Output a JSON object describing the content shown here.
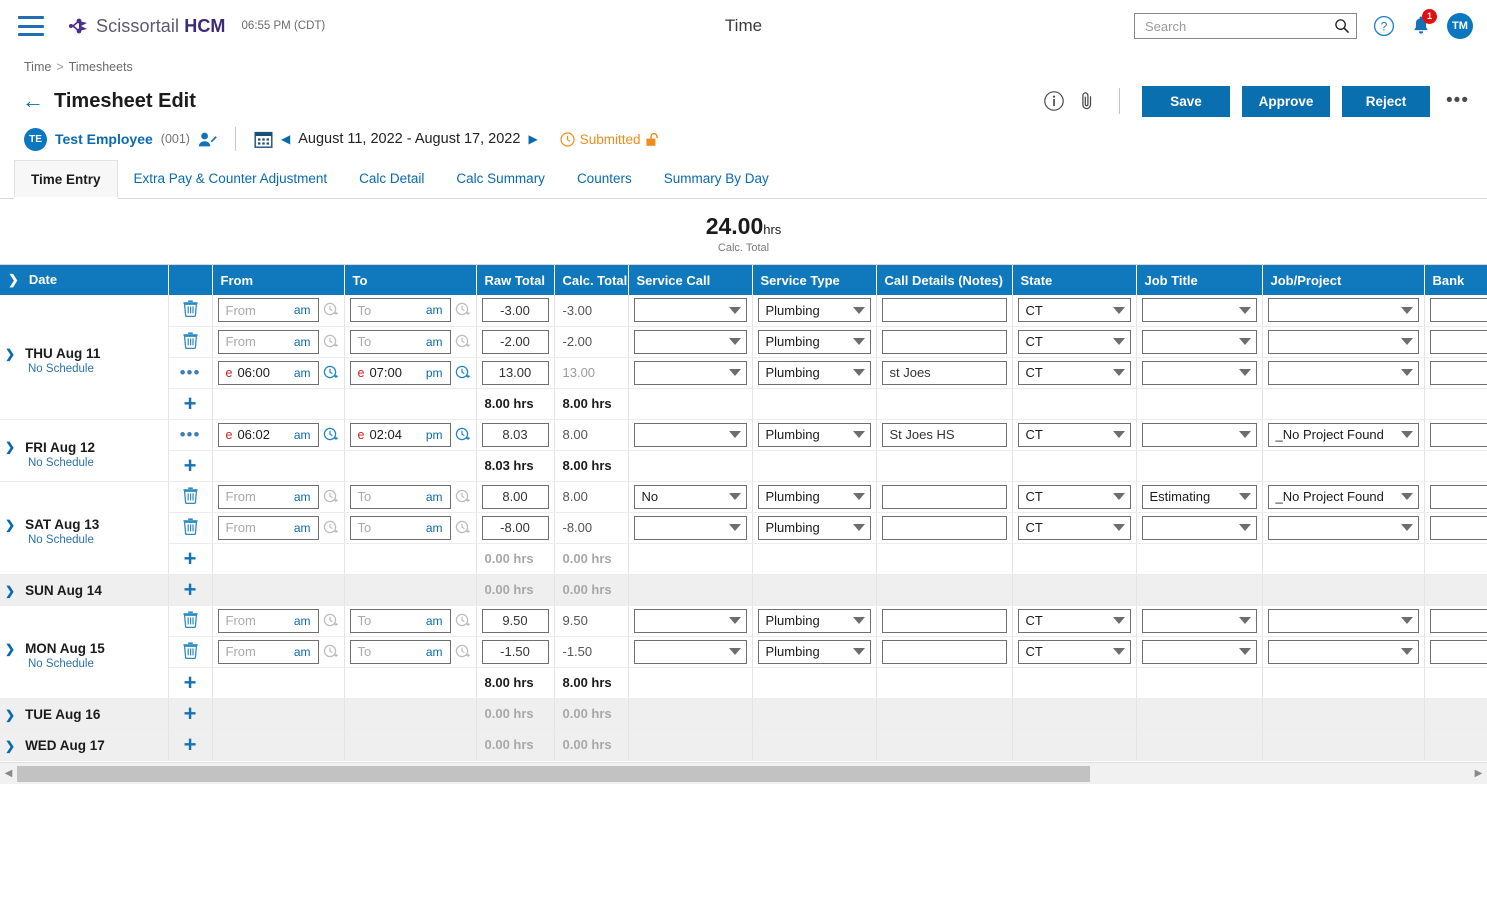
{
  "topbar": {
    "menu_icon": "hamburger-icon",
    "brand": "Scissortail ",
    "brand_bold": "HCM",
    "clock": "06:55 PM (CDT)",
    "page_title": "Time",
    "search": {
      "value": "",
      "placeholder": "Search"
    },
    "help_icon": "help-circle-icon",
    "notifications_icon": "bell-icon",
    "notifications_count": "1",
    "avatar_initials": "TM"
  },
  "breadcrumb": {
    "root": "Time",
    "separator": ">",
    "current": "Timesheets"
  },
  "header": {
    "back_icon": "back-arrow-icon",
    "title": "Timesheet Edit",
    "info_icon": "info-circle-icon",
    "attach_icon": "paperclip-icon",
    "save_label": "Save",
    "approve_label": "Approve",
    "reject_label": "Reject",
    "more_label": "•••"
  },
  "employee": {
    "avatar_initials": "TE",
    "name": "Test Employee",
    "id": "(001)",
    "edit_icon": "user-edit-icon",
    "calendar_icon": "calendar-icon",
    "prev_icon": "◀",
    "period": "August 11, 2022 - August 17, 2022",
    "next_icon": "▶",
    "status_icon": "clock-icon",
    "status": "Submitted",
    "lock_icon": "unlock-icon"
  },
  "tabs": [
    {
      "label": "Time Entry",
      "active": true
    },
    {
      "label": "Extra Pay & Counter Adjustment",
      "active": false
    },
    {
      "label": "Calc Detail",
      "active": false
    },
    {
      "label": "Calc Summary",
      "active": false
    },
    {
      "label": "Counters",
      "active": false
    },
    {
      "label": "Summary By Day",
      "active": false
    }
  ],
  "summary": {
    "value": "24.00",
    "unit": "hrs",
    "label": "Calc. Total"
  },
  "grid": {
    "columns": [
      "Date",
      "",
      "From",
      "To",
      "Raw Total",
      "Calc. Total",
      "Service Call",
      "Service Type",
      "Call Details (Notes)",
      "State",
      "Job Title",
      "Job/Project",
      "Bank"
    ],
    "placeholders": {
      "from": "From",
      "to": "To",
      "am": "am",
      "pm": "pm"
    },
    "days": [
      {
        "label": "THU Aug 11",
        "schedule": "No Schedule",
        "expanded": true,
        "rows": [
          {
            "action": "trash",
            "from_e": "",
            "from": "",
            "from_ampm": "am",
            "from_empty": true,
            "to_e": "",
            "to": "",
            "to_ampm": "am",
            "to_empty": true,
            "raw": "-3.00",
            "calc": "-3.00",
            "service_call": "",
            "service_type": "Plumbing",
            "notes": "",
            "state": "CT",
            "job_title": "",
            "job_project": "",
            "bank": ""
          },
          {
            "action": "trash",
            "from_e": "",
            "from": "",
            "from_ampm": "am",
            "from_empty": true,
            "to_e": "",
            "to": "",
            "to_ampm": "am",
            "to_empty": true,
            "raw": "-2.00",
            "calc": "-2.00",
            "service_call": "",
            "service_type": "Plumbing",
            "notes": "",
            "state": "CT",
            "job_title": "",
            "job_project": "",
            "bank": ""
          },
          {
            "action": "dots",
            "from_e": "e",
            "from": "06:00",
            "from_ampm": "am",
            "from_empty": false,
            "to_e": "e",
            "to": "07:00",
            "to_ampm": "pm",
            "to_empty": false,
            "raw": "13.00",
            "calc": "13.00",
            "service_call": "",
            "service_type": "Plumbing",
            "notes": "st Joes",
            "state": "CT",
            "job_title": "",
            "job_project": "",
            "bank": ""
          }
        ],
        "total_raw": "8.00 hrs",
        "total_calc": "8.00 hrs",
        "total_muted": false
      },
      {
        "label": "FRI Aug 12",
        "schedule": "No Schedule",
        "expanded": true,
        "rows": [
          {
            "action": "dots",
            "from_e": "e",
            "from": "06:02",
            "from_ampm": "am",
            "from_empty": false,
            "to_e": "e",
            "to": "02:04",
            "to_ampm": "pm",
            "to_empty": false,
            "raw": "8.03",
            "calc": "8.00",
            "service_call": "",
            "service_type": "Plumbing",
            "notes": "St Joes HS",
            "state": "CT",
            "job_title": "",
            "job_project": "_No Project Found",
            "bank": ""
          }
        ],
        "total_raw": "8.03 hrs",
        "total_calc": "8.00 hrs",
        "total_muted": false
      },
      {
        "label": "SAT Aug 13",
        "schedule": "No Schedule",
        "expanded": true,
        "rows": [
          {
            "action": "trash",
            "from_e": "",
            "from": "",
            "from_ampm": "am",
            "from_empty": true,
            "to_e": "",
            "to": "",
            "to_ampm": "am",
            "to_empty": true,
            "raw": "8.00",
            "calc": "8.00",
            "service_call": "No",
            "service_type": "Plumbing",
            "notes": "",
            "state": "CT",
            "job_title": "Estimating",
            "job_project": "_No Project Found",
            "bank": ""
          },
          {
            "action": "trash",
            "from_e": "",
            "from": "",
            "from_ampm": "am",
            "from_empty": true,
            "to_e": "",
            "to": "",
            "to_ampm": "am",
            "to_empty": true,
            "raw": "-8.00",
            "calc": "-8.00",
            "service_call": "",
            "service_type": "Plumbing",
            "notes": "",
            "state": "CT",
            "job_title": "",
            "job_project": "",
            "bank": ""
          }
        ],
        "total_raw": "0.00 hrs",
        "total_calc": "0.00 hrs",
        "total_muted": true
      },
      {
        "label": "SUN Aug 14",
        "schedule": "",
        "expanded": false,
        "rows": [],
        "total_raw": "0.00 hrs",
        "total_calc": "0.00 hrs",
        "total_muted": true
      },
      {
        "label": "MON Aug 15",
        "schedule": "No Schedule",
        "expanded": true,
        "rows": [
          {
            "action": "trash",
            "from_e": "",
            "from": "",
            "from_ampm": "am",
            "from_empty": true,
            "to_e": "",
            "to": "",
            "to_ampm": "am",
            "to_empty": true,
            "raw": "9.50",
            "calc": "9.50",
            "service_call": "",
            "service_type": "Plumbing",
            "notes": "",
            "state": "CT",
            "job_title": "",
            "job_project": "",
            "bank": ""
          },
          {
            "action": "trash",
            "from_e": "",
            "from": "",
            "from_ampm": "am",
            "from_empty": true,
            "to_e": "",
            "to": "",
            "to_ampm": "am",
            "to_empty": true,
            "raw": "-1.50",
            "calc": "-1.50",
            "service_call": "",
            "service_type": "Plumbing",
            "notes": "",
            "state": "CT",
            "job_title": "",
            "job_project": "",
            "bank": ""
          }
        ],
        "total_raw": "8.00 hrs",
        "total_calc": "8.00 hrs",
        "total_muted": false
      },
      {
        "label": "TUE Aug 16",
        "schedule": "",
        "expanded": false,
        "rows": [],
        "total_raw": "0.00 hrs",
        "total_calc": "0.00 hrs",
        "total_muted": true
      },
      {
        "label": "WED Aug 17",
        "schedule": "",
        "expanded": false,
        "rows": [],
        "total_raw": "0.00 hrs",
        "total_calc": "0.00 hrs",
        "total_muted": true
      }
    ]
  },
  "scrollbar": {
    "left_arrow": "◀",
    "right_arrow": "▶"
  },
  "colors": {
    "header_blue": "#1079bd",
    "button_blue": "#0a6fae",
    "link_blue": "#0a6ab0",
    "status_orange": "#f08c1a",
    "badge_red": "#e01010",
    "date_header_black": "#000000"
  }
}
